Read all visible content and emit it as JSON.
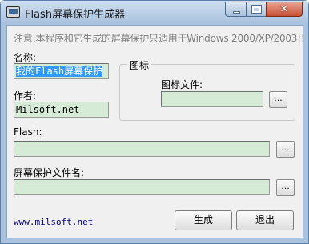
{
  "window": {
    "title": "Flash屏幕保护生成器"
  },
  "titlebar_buttons": {
    "close_glyph": "✕"
  },
  "notice": "注意:本程序和它生成的屏幕保护只适用于Windows 2000/XP/2003!!",
  "name": {
    "label": "名称:",
    "value": "我的Flash屏幕保护"
  },
  "author": {
    "label": "作者:",
    "value": "Milsoft.net"
  },
  "icon_group": {
    "legend": "图标",
    "file_label": "图标文件:",
    "file_value": "",
    "browse_label": "..."
  },
  "flash": {
    "label": "Flash:",
    "value": "",
    "browse_label": "..."
  },
  "saver_file": {
    "label": "屏幕保护文件名:",
    "value": "",
    "browse_label": "..."
  },
  "footer": {
    "link": "www.milsoft.net",
    "generate_label": "生成",
    "exit_label": "退出"
  },
  "colors": {
    "field_bg": "#d6ebd6",
    "selection": "#3399ff",
    "link": "#000080",
    "close_button": "#c75135"
  }
}
